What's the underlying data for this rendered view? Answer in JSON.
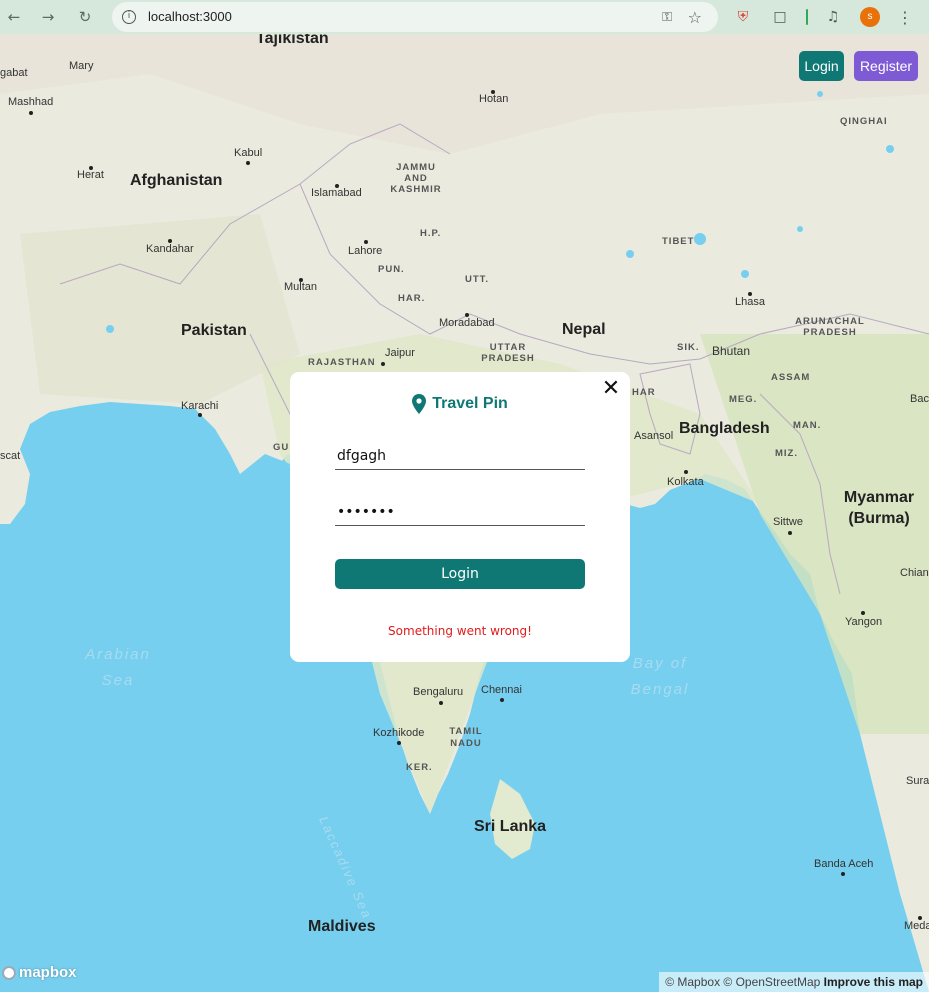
{
  "browser": {
    "url": "localhost:3000",
    "profile_initial": "s",
    "icons": {
      "back": "arrow-left-icon",
      "forward": "arrow-right-icon",
      "reload": "reload-icon",
      "info": "info-icon",
      "key": "key-icon",
      "star": "star-icon",
      "extension_shield": "shield-icon",
      "puzzle": "puzzle-icon",
      "media": "media-icon",
      "menu": "kebab-menu-icon"
    }
  },
  "header": {
    "login_label": "Login",
    "register_label": "Register",
    "colors": {
      "login": "#0f7875",
      "register": "#7e5bd5"
    }
  },
  "modal": {
    "title": "Travel Pin",
    "username_value": "dfgagh",
    "password_value": "•••••••",
    "submit_label": "Login",
    "error_text": "Something went wrong!",
    "icons": {
      "pin": "map-pin-icon",
      "close": "close-icon"
    },
    "colors": {
      "accent": "#0f7875",
      "error": "#e01b1b"
    }
  },
  "map": {
    "countries": [
      "Tajikistan",
      "Afghanistan",
      "Pakistan",
      "Nepal",
      "Bangladesh",
      "Bhutan",
      "Myanmar (Burma)",
      "Sri Lanka",
      "Maldives"
    ],
    "regions": [
      "JAMMU AND KASHMIR",
      "H.P.",
      "PUN.",
      "HAR.",
      "UTT.",
      "RAJASTHAN",
      "UTTAR PRADESH",
      "SIK.",
      "MEG.",
      "ASSAM",
      "MAN.",
      "MIZ.",
      "ARUNACHAL PRADESH",
      "TIBET",
      "QINGHAI",
      "TAMIL NADU",
      "KER.",
      "GU",
      "HAR"
    ],
    "cities": [
      "Mary",
      "Mashhad",
      "Herat",
      "Kabul",
      "Islamabad",
      "Kandahar",
      "Lahore",
      "Multan",
      "Karachi",
      "Jaipur",
      "Moradabad",
      "Hotan",
      "Lhasa",
      "Asansol",
      "Kolkata",
      "Sittwe",
      "Yangon",
      "Bengaluru",
      "Chennai",
      "Kozhikode",
      "Banda Aceh",
      "gabat",
      "scat",
      "Bac",
      "Chian",
      "Sura",
      "Meda"
    ],
    "seas": [
      "Arabian Sea",
      "Bay of Bengal",
      "Laccadive Sea"
    ],
    "logo": "mapbox",
    "attribution": "© Mapbox © OpenStreetMap",
    "improve_link": "Improve this map"
  }
}
